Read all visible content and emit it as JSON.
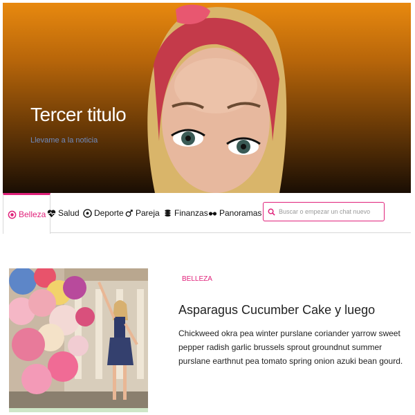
{
  "hero": {
    "title": "Tercer titulo",
    "link_label": "Llevame a la noticia"
  },
  "nav": {
    "items": [
      {
        "label": "Belleza",
        "icon": "eye-icon",
        "active": true
      },
      {
        "label": "Salud",
        "icon": "heartbeat-icon",
        "active": false
      },
      {
        "label": "Deporte",
        "icon": "soccer-ball-icon",
        "active": false
      },
      {
        "label": "Pareja",
        "icon": "gender-icon",
        "active": false
      },
      {
        "label": "Finanzas",
        "icon": "coins-icon",
        "active": false
      },
      {
        "label": "Panoramas",
        "icon": "glasses-icon",
        "active": false
      }
    ]
  },
  "search": {
    "placeholder": "Buscar o empezar un chat nuevo"
  },
  "article": {
    "category": "BELLEZA",
    "title": "Asparagus Cucumber Cake y luego",
    "body": "Chickweed okra pea winter purslane coriander yarrow sweet pepper radish garlic brussels sprout groundnut summer purslane earthnut pea tomato spring onion azuki bean gourd."
  },
  "colors": {
    "accent": "#e0217a",
    "hero_top": "#e8890f",
    "hero_bottom": "#1a0e04",
    "link": "#6f8bc0"
  }
}
